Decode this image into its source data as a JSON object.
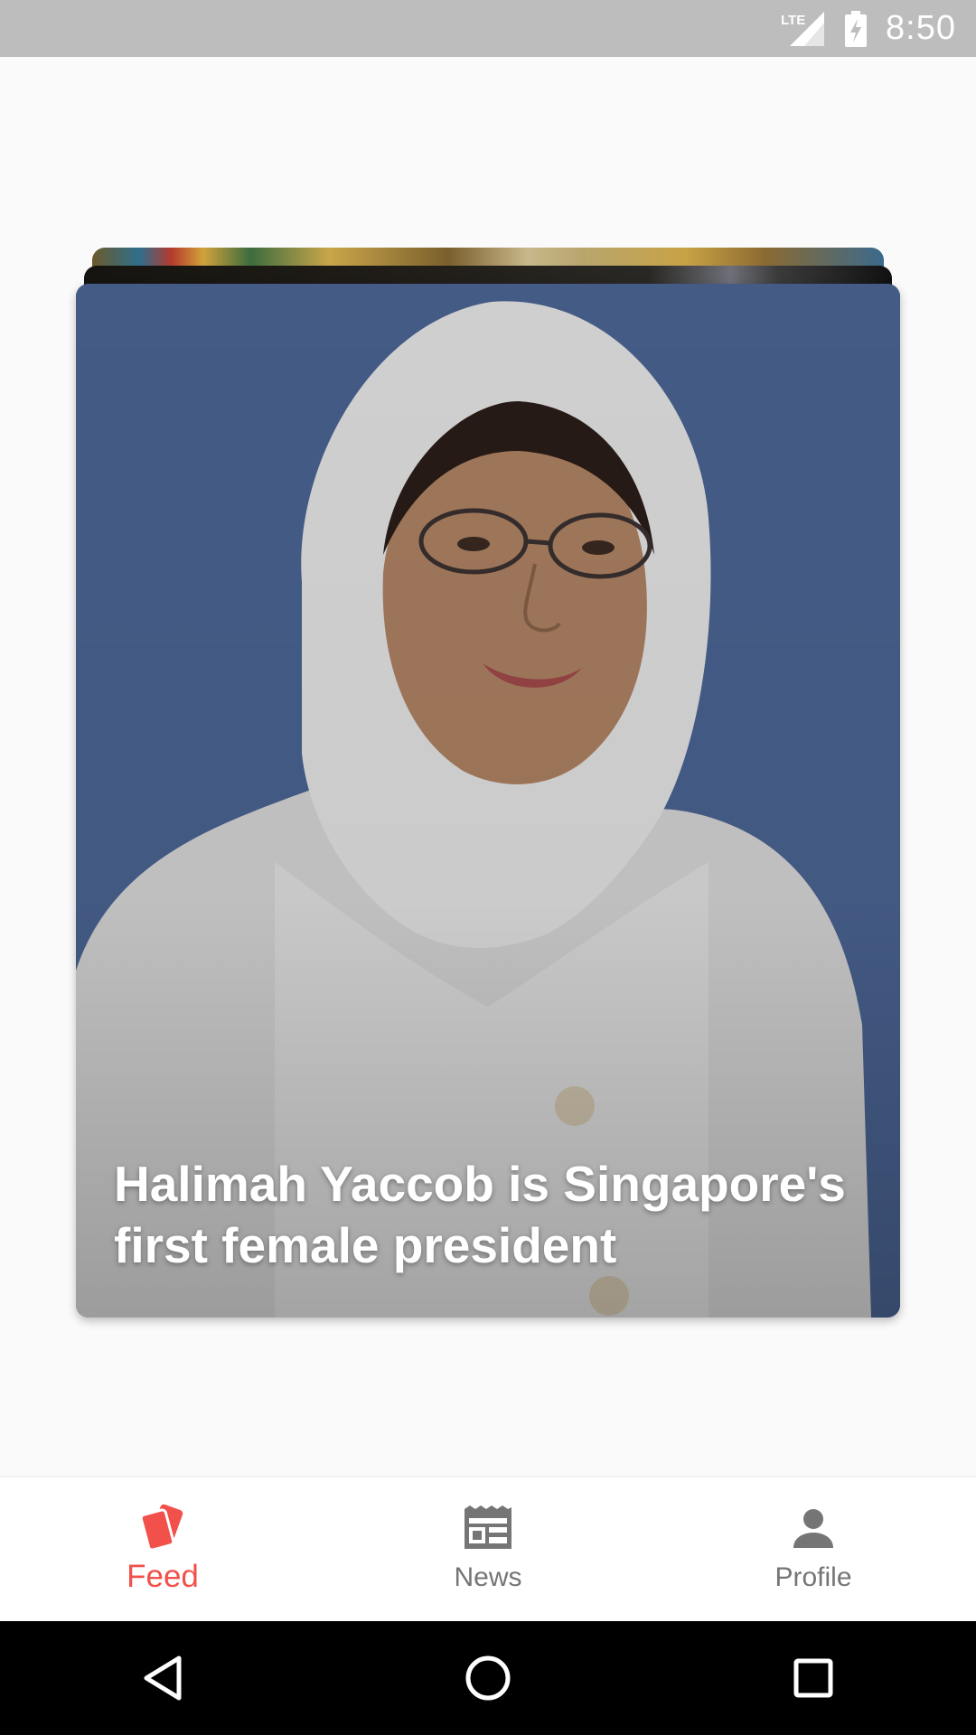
{
  "status_bar": {
    "time": "8:50",
    "network": "LTE",
    "icons": [
      "lte-signal-icon",
      "battery-charging-icon"
    ]
  },
  "card": {
    "headline": "Halimah Yaccob is Singapore's first female president",
    "image": "portrait-photo"
  },
  "bottom_nav": {
    "items": [
      {
        "label": "Feed",
        "icon": "cards-icon",
        "active": true
      },
      {
        "label": "News",
        "icon": "newspaper-icon",
        "active": false
      },
      {
        "label": "Profile",
        "icon": "person-icon",
        "active": false
      }
    ]
  },
  "colors": {
    "accent": "#f2504b",
    "inactive": "#757575",
    "status_bar": "#bdbdbd",
    "card_background": "#4a6494"
  },
  "system_nav": {
    "buttons": [
      "back-icon",
      "home-icon",
      "recents-icon"
    ]
  }
}
